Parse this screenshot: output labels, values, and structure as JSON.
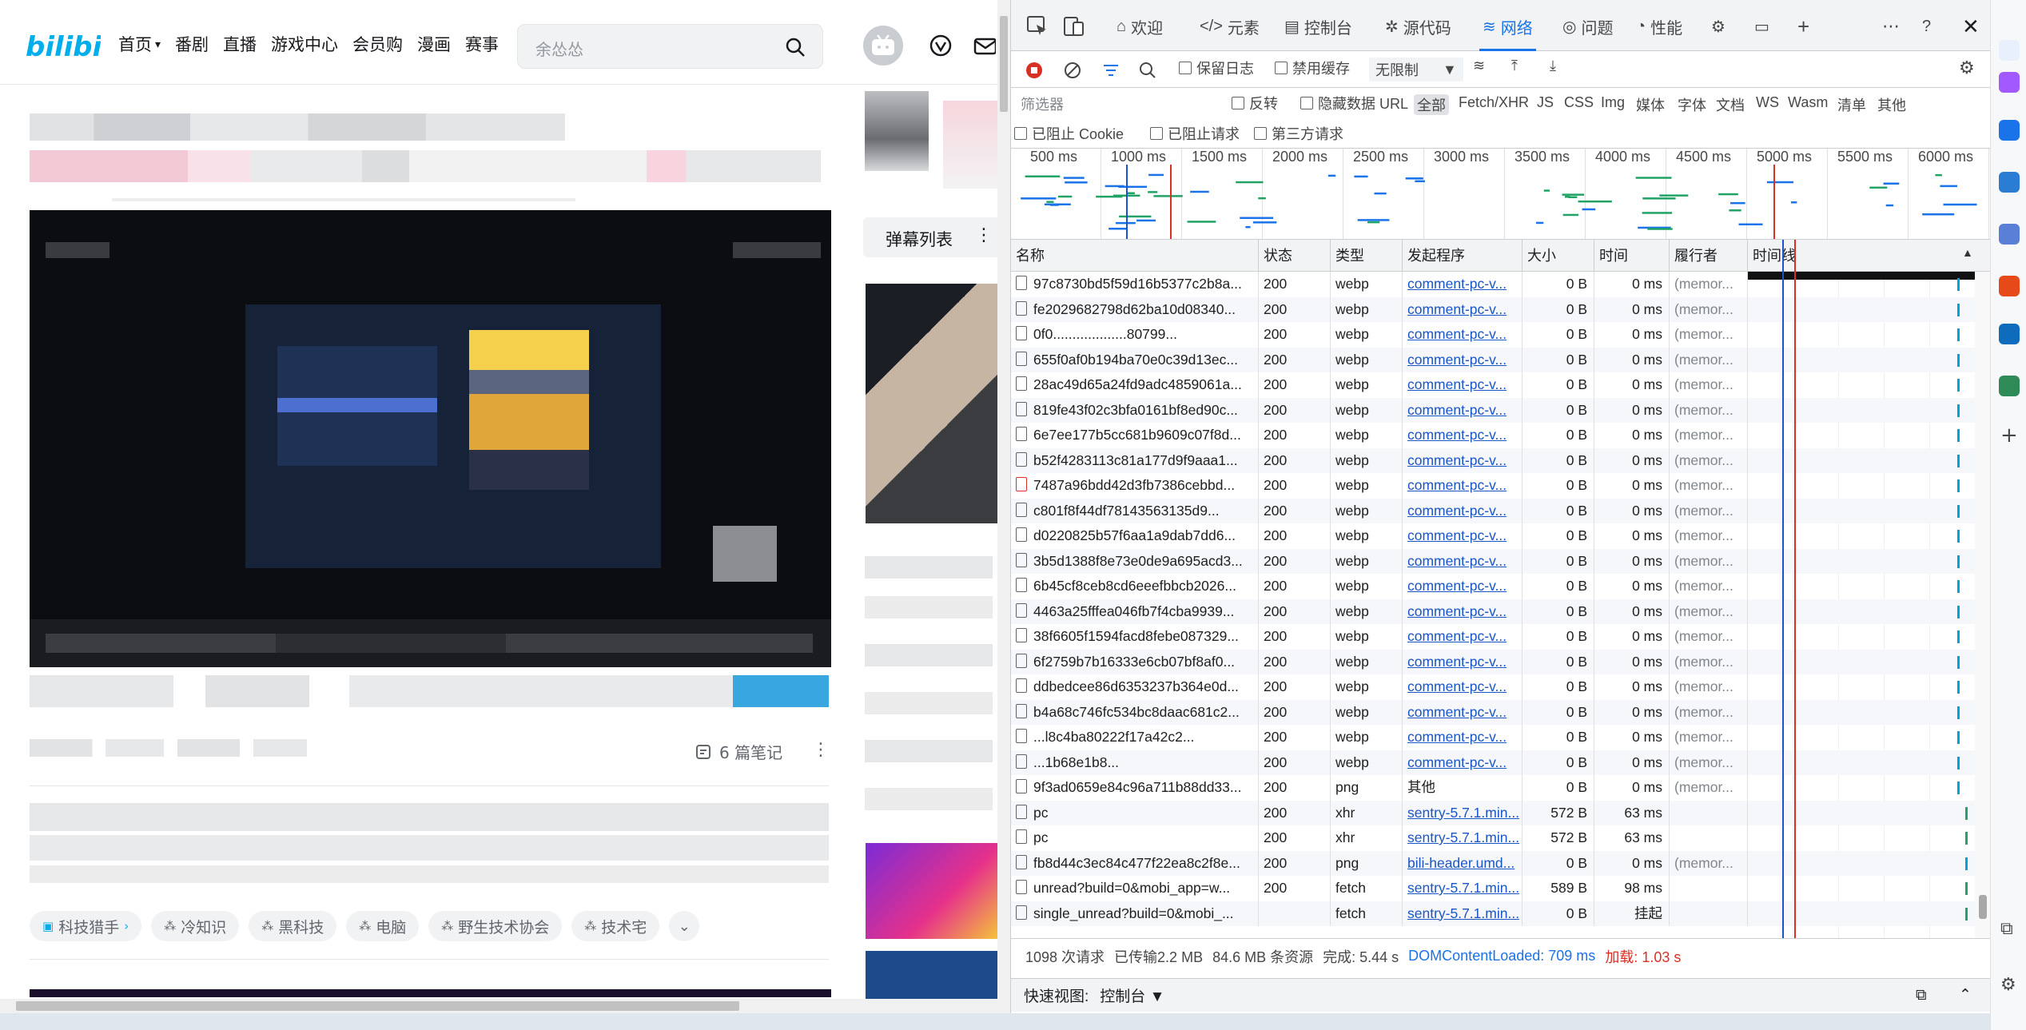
{
  "bili": {
    "logo": "bilibili",
    "nav": [
      {
        "label": "首页",
        "chevron": true
      },
      {
        "label": "番剧"
      },
      {
        "label": "直播"
      },
      {
        "label": "游戏中心"
      },
      {
        "label": "会员购"
      },
      {
        "label": "漫画"
      },
      {
        "label": "赛事"
      }
    ],
    "search_placeholder": "余怂怂",
    "notes_label": "6 篇笔记",
    "danmaku_title": "弹幕列表",
    "tags": [
      "科技猎手",
      "冷知识",
      "黑科技",
      "电脑",
      "野生技术协会",
      "技术宅"
    ]
  },
  "devtools": {
    "tabs": [
      {
        "label": "欢迎",
        "icon": "home-icon"
      },
      {
        "label": "元素",
        "icon": "code-icon"
      },
      {
        "label": "控制台",
        "icon": "console-icon"
      },
      {
        "label": "源代码",
        "icon": "bug-icon"
      },
      {
        "label": "网络",
        "icon": "wifi-icon",
        "active": true
      },
      {
        "label": "问题",
        "icon": "issues-icon"
      },
      {
        "label": "性能",
        "icon": "performance-icon"
      }
    ],
    "toolbar": {
      "preserve_log": "保留日志",
      "disable_cache": "禁用缓存",
      "throttle": "无限制"
    },
    "filter": {
      "placeholder": "筛选器",
      "invert": "反转",
      "hide_data_url": "隐藏数据 URL",
      "types": [
        "全部",
        "Fetch/XHR",
        "JS",
        "CSS",
        "Img",
        "媒体",
        "字体",
        "文档",
        "WS",
        "Wasm",
        "清单",
        "其他"
      ],
      "blocked_cookies": "已阻止 Cookie",
      "blocked_requests": "已阻止请求",
      "third_party": "第三方请求"
    },
    "overview_ticks": [
      "500 ms",
      "1000 ms",
      "1500 ms",
      "2000 ms",
      "2500 ms",
      "3000 ms",
      "3500 ms",
      "4000 ms",
      "4500 ms",
      "5000 ms",
      "5500 ms",
      "6000 ms"
    ],
    "columns": [
      "名称",
      "状态",
      "类型",
      "发起程序",
      "大小",
      "时间",
      "履行者",
      "时间线"
    ],
    "rows": [
      {
        "name": "97c8730bd5f59d16b5377c2b8a...",
        "status": "200",
        "type": "webp",
        "initiator": "comment-pc-v...",
        "size": "0 B",
        "time": "0 ms",
        "fulfilled": "(memor..."
      },
      {
        "name": "fe2029682798d62ba10d08340...",
        "status": "200",
        "type": "webp",
        "initiator": "comment-pc-v...",
        "size": "0 B",
        "time": "0 ms",
        "fulfilled": "(memor..."
      },
      {
        "name": "0f0...................80799...",
        "status": "200",
        "type": "webp",
        "initiator": "comment-pc-v...",
        "size": "0 B",
        "time": "0 ms",
        "fulfilled": "(memor..."
      },
      {
        "name": "655f0af0b194ba70e0c39d13ec...",
        "status": "200",
        "type": "webp",
        "initiator": "comment-pc-v...",
        "size": "0 B",
        "time": "0 ms",
        "fulfilled": "(memor..."
      },
      {
        "name": "28ac49d65a24fd9adc4859061a...",
        "status": "200",
        "type": "webp",
        "initiator": "comment-pc-v...",
        "size": "0 B",
        "time": "0 ms",
        "fulfilled": "(memor..."
      },
      {
        "name": "819fe43f02c3bfa0161bf8ed90c...",
        "status": "200",
        "type": "webp",
        "initiator": "comment-pc-v...",
        "size": "0 B",
        "time": "0 ms",
        "fulfilled": "(memor..."
      },
      {
        "name": "6e7ee177b5cc681b9609c07f8d...",
        "status": "200",
        "type": "webp",
        "initiator": "comment-pc-v...",
        "size": "0 B",
        "time": "0 ms",
        "fulfilled": "(memor..."
      },
      {
        "name": "b52f4283113c81a177d9f9aaa1...",
        "status": "200",
        "type": "webp",
        "initiator": "comment-pc-v...",
        "size": "0 B",
        "time": "0 ms",
        "fulfilled": "(memor..."
      },
      {
        "name": "7487a96bdd42d3fb7386cebbd...",
        "status": "200",
        "type": "webp",
        "initiator": "comment-pc-v...",
        "size": "0 B",
        "time": "0 ms",
        "fulfilled": "(memor...",
        "red": true
      },
      {
        "name": "c801f8f44df78143563135d9...",
        "status": "200",
        "type": "webp",
        "initiator": "comment-pc-v...",
        "size": "0 B",
        "time": "0 ms",
        "fulfilled": "(memor..."
      },
      {
        "name": "d0220825b57f6aa1a9dab7dd6...",
        "status": "200",
        "type": "webp",
        "initiator": "comment-pc-v...",
        "size": "0 B",
        "time": "0 ms",
        "fulfilled": "(memor..."
      },
      {
        "name": "3b5d1388f8e73e0de9a695acd3...",
        "status": "200",
        "type": "webp",
        "initiator": "comment-pc-v...",
        "size": "0 B",
        "time": "0 ms",
        "fulfilled": "(memor..."
      },
      {
        "name": "6b45cf8ceb8cd6eeefbbcb2026...",
        "status": "200",
        "type": "webp",
        "initiator": "comment-pc-v...",
        "size": "0 B",
        "time": "0 ms",
        "fulfilled": "(memor..."
      },
      {
        "name": "4463a25fffea046fb7f4cba9939...",
        "status": "200",
        "type": "webp",
        "initiator": "comment-pc-v...",
        "size": "0 B",
        "time": "0 ms",
        "fulfilled": "(memor..."
      },
      {
        "name": "38f6605f1594facd8febe087329...",
        "status": "200",
        "type": "webp",
        "initiator": "comment-pc-v...",
        "size": "0 B",
        "time": "0 ms",
        "fulfilled": "(memor..."
      },
      {
        "name": "6f2759b7b16333e6cb07bf8af0...",
        "status": "200",
        "type": "webp",
        "initiator": "comment-pc-v...",
        "size": "0 B",
        "time": "0 ms",
        "fulfilled": "(memor..."
      },
      {
        "name": "ddbedcee86d6353237b364e0d...",
        "status": "200",
        "type": "webp",
        "initiator": "comment-pc-v...",
        "size": "0 B",
        "time": "0 ms",
        "fulfilled": "(memor..."
      },
      {
        "name": "b4a68c746fc534bc8daac681c2...",
        "status": "200",
        "type": "webp",
        "initiator": "comment-pc-v...",
        "size": "0 B",
        "time": "0 ms",
        "fulfilled": "(memor..."
      },
      {
        "name": "...l8c4ba80222f17a42c2...",
        "status": "200",
        "type": "webp",
        "initiator": "comment-pc-v...",
        "size": "0 B",
        "time": "0 ms",
        "fulfilled": "(memor..."
      },
      {
        "name": "...1b68e1b8...",
        "status": "200",
        "type": "webp",
        "initiator": "comment-pc-v...",
        "size": "0 B",
        "time": "0 ms",
        "fulfilled": "(memor..."
      },
      {
        "name": "9f3ad0659e84c96a711b88dd33...",
        "status": "200",
        "type": "png",
        "initiator": "其他",
        "size": "0 B",
        "time": "0 ms",
        "fulfilled": "(memor...",
        "plain_initiator": true
      },
      {
        "name": "pc",
        "status": "200",
        "type": "xhr",
        "initiator": "sentry-5.7.1.min...",
        "size": "572 B",
        "time": "63 ms",
        "fulfilled": ""
      },
      {
        "name": "pc",
        "status": "200",
        "type": "xhr",
        "initiator": "sentry-5.7.1.min...",
        "size": "572 B",
        "time": "63 ms",
        "fulfilled": ""
      },
      {
        "name": "fb8d44c3ec84c477f22ea8c2f8e...",
        "status": "200",
        "type": "png",
        "initiator": "bili-header.umd...",
        "size": "0 B",
        "time": "0 ms",
        "fulfilled": "(memor..."
      },
      {
        "name": "unread?build=0&mobi_app=w...",
        "status": "200",
        "type": "fetch",
        "initiator": "sentry-5.7.1.min...",
        "size": "589 B",
        "time": "98 ms",
        "fulfilled": ""
      },
      {
        "name": "single_unread?build=0&mobi_...",
        "status": "",
        "type": "fetch",
        "initiator": "sentry-5.7.1.min...",
        "size": "0 B",
        "time": "挂起",
        "fulfilled": ""
      }
    ],
    "status": {
      "requests": "1098 次请求",
      "transferred": "已传输2.2 MB",
      "resources": "84.6 MB 条资源",
      "finish": "完成: 5.44 s",
      "dcl": "DOMContentLoaded: 709 ms",
      "load": "加载: 1.03 s"
    },
    "drawer": {
      "label": "快速视图:",
      "value": "控制台"
    },
    "colors": {
      "accent": "#1a73e8",
      "dcl_line": "#1a55c5",
      "load_line": "#d93025"
    }
  }
}
